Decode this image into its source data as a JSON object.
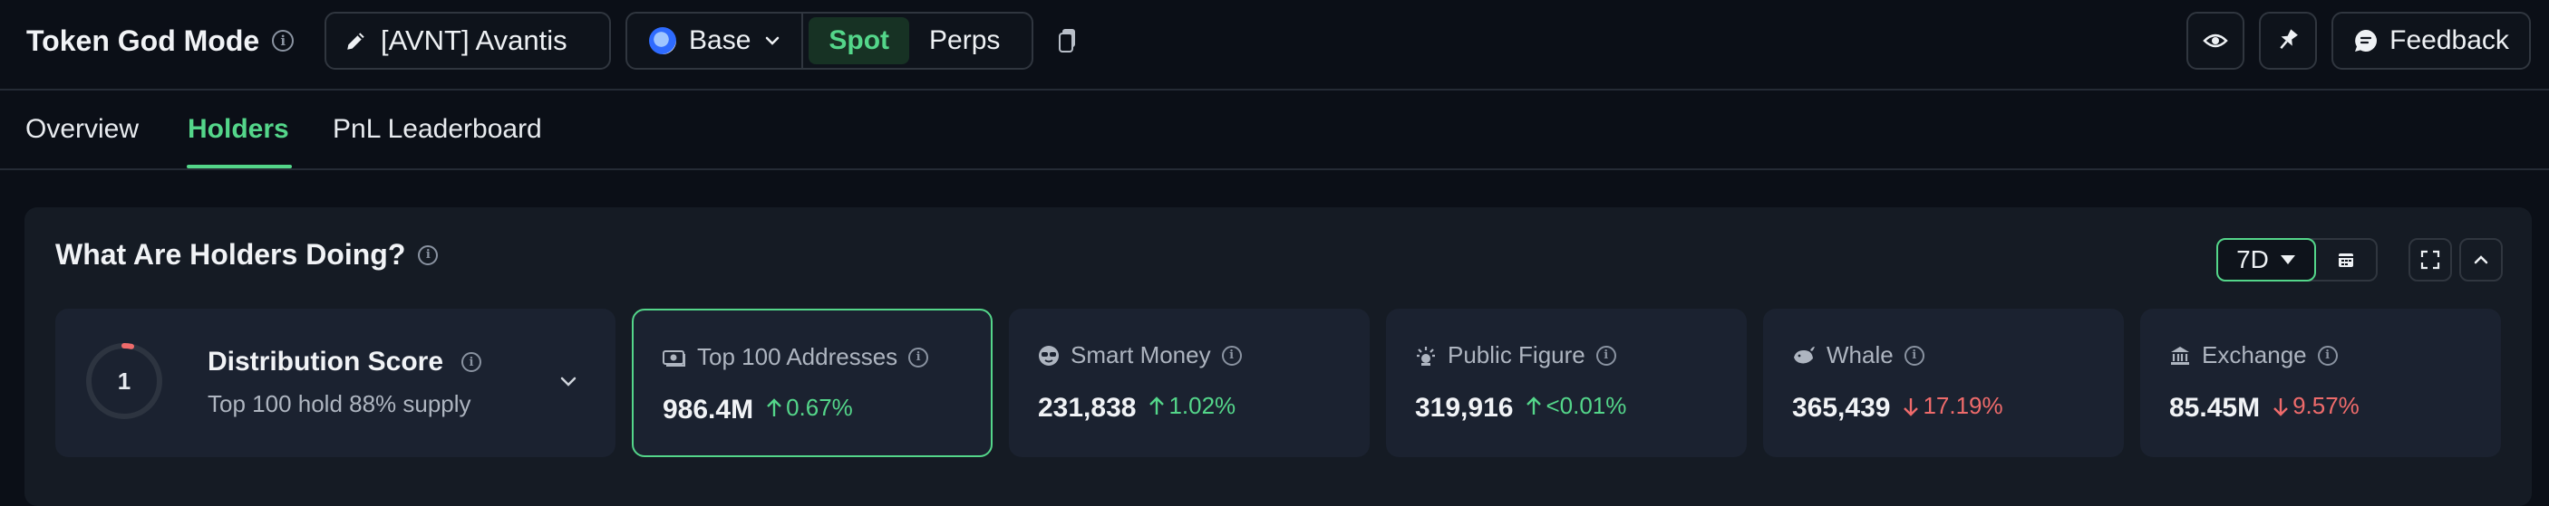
{
  "header": {
    "app_title": "Token God Mode",
    "token_label": "[AVNT] Avantis",
    "chain": "Base",
    "market_segments": [
      "Spot",
      "Perps"
    ],
    "active_segment": "Spot",
    "feedback_label": "Feedback",
    "icons": [
      "info-icon",
      "pencil-icon",
      "base-chain-icon",
      "chevron-down-icon",
      "copy-icon",
      "eye-icon",
      "pin-icon",
      "chat-bubble-icon"
    ]
  },
  "tabs": {
    "items": [
      {
        "label": "Overview"
      },
      {
        "label": "Holders"
      },
      {
        "label": "PnL Leaderboard"
      }
    ],
    "active": "Holders"
  },
  "panel": {
    "title": "What Are Holders Doing?",
    "period": "7D",
    "icons": [
      "calendar-icon",
      "fullscreen-icon",
      "chevron-up-icon"
    ],
    "distribution": {
      "score": "1",
      "title": "Distribution Score",
      "subtitle": "Top 100 hold 88% supply"
    },
    "cards": [
      {
        "label": "Top 100 Addresses",
        "value": "986.4M",
        "change": "0.67%",
        "direction": "up",
        "icon": "cash-icon"
      },
      {
        "label": "Smart Money",
        "value": "231,838",
        "change": "1.02%",
        "direction": "up",
        "icon": "sunglasses-icon"
      },
      {
        "label": "Public Figure",
        "value": "319,916",
        "change": "<0.01%",
        "direction": "up",
        "icon": "spotlight-icon"
      },
      {
        "label": "Whale",
        "value": "365,439",
        "change": "17.19%",
        "direction": "down",
        "icon": "whale-icon"
      },
      {
        "label": "Exchange",
        "value": "85.45M",
        "change": "9.57%",
        "direction": "down",
        "icon": "bank-icon"
      }
    ]
  },
  "colors": {
    "background": "#0b0f17",
    "panel": "#151b24",
    "card": "#1b2230",
    "accent_green": "#54d68a",
    "down_red": "#ef6b6b"
  }
}
